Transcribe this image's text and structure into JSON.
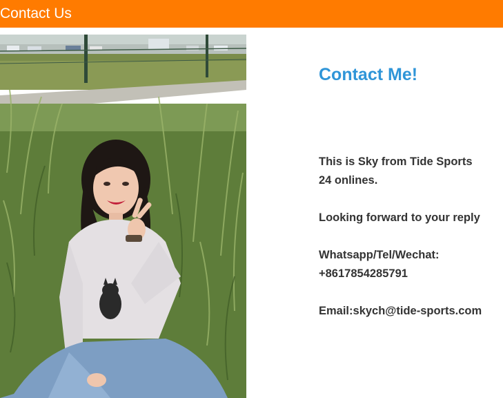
{
  "header": {
    "title": "Contact Us"
  },
  "photo": {
    "alt": "Smiling woman sitting in tall grass making a peace sign"
  },
  "contact": {
    "heading": "Contact Me!",
    "intro_line1": "This is Sky from Tide Sports",
    "intro_line2": "24 onlines.",
    "reply": "Looking forward to your reply",
    "phone_label": "Whatsapp/Tel/Wechat:",
    "phone": "+8617854285791",
    "email": "Email:skych@tide-sports.com"
  },
  "colors": {
    "header_bg": "#ff7b00",
    "heading": "#2f95d8",
    "body_text": "#333333"
  }
}
